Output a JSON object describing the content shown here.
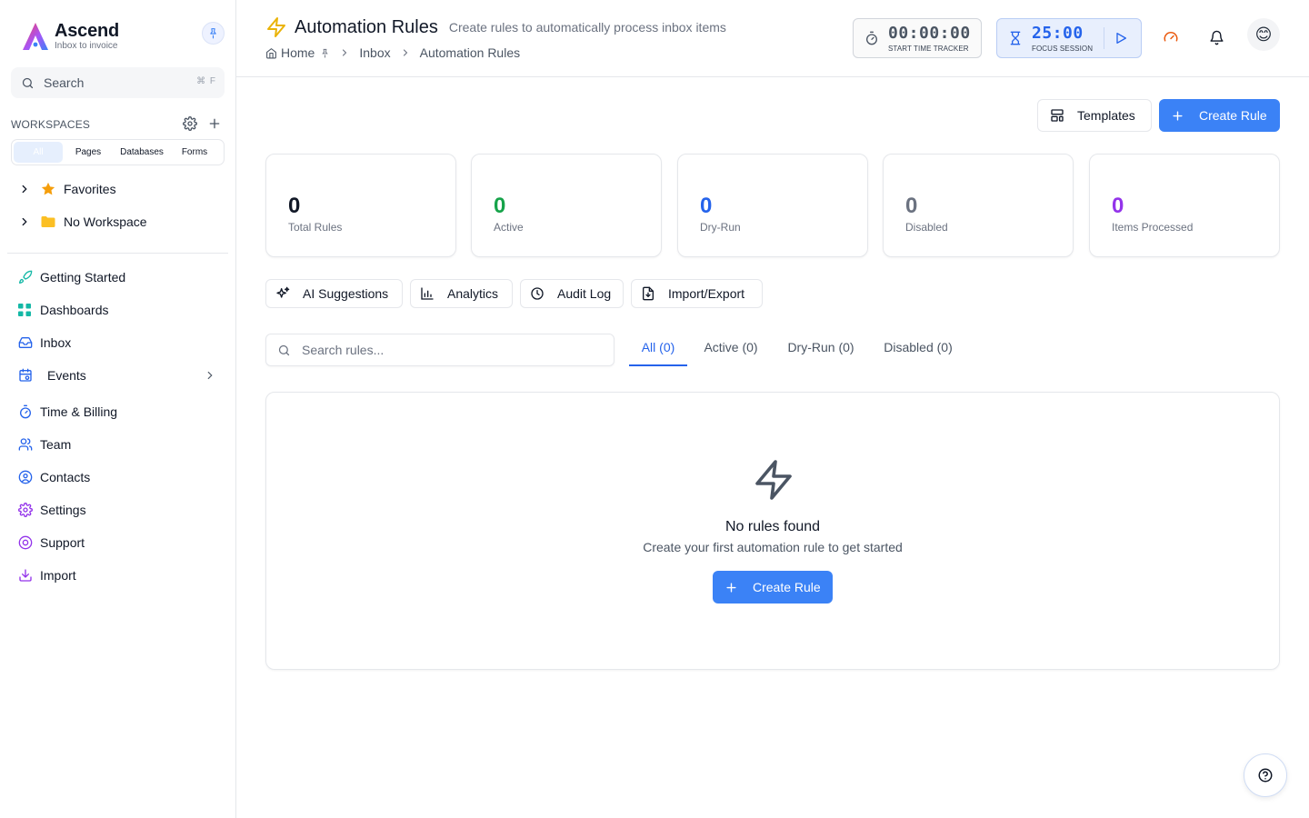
{
  "app": {
    "name": "Ascend",
    "tagline": "Inbox to invoice"
  },
  "sidebar": {
    "search_label": "Search",
    "search_shortcut": "⌘ F",
    "workspaces_title": "WORKSPACES",
    "ws_tabs": [
      "All",
      "Pages",
      "Databases",
      "Forms"
    ],
    "tree": [
      {
        "label": "Favorites",
        "icon": "star-icon"
      },
      {
        "label": "No Workspace",
        "icon": "folder-icon"
      }
    ],
    "nav": [
      {
        "label": "Getting Started",
        "icon": "rocket-icon"
      },
      {
        "label": "Dashboards",
        "icon": "grid-icon"
      },
      {
        "label": "Inbox",
        "icon": "inbox-icon"
      },
      {
        "label": "Events",
        "icon": "calendar-icon"
      },
      {
        "label": "Time & Billing",
        "icon": "timer-icon"
      },
      {
        "label": "Team",
        "icon": "users-icon"
      },
      {
        "label": "Contacts",
        "icon": "contact-icon"
      },
      {
        "label": "Settings",
        "icon": "gear-icon"
      },
      {
        "label": "Support",
        "icon": "lifebuoy-icon"
      },
      {
        "label": "Import",
        "icon": "download-icon"
      }
    ]
  },
  "header": {
    "title": "Automation Rules",
    "subtitle": "Create rules to automatically process inbox items",
    "breadcrumb": [
      "Home",
      "Inbox",
      "Automation Rules"
    ],
    "time_tracker": {
      "value": "00:00:00",
      "caption": "START TIME TRACKER"
    },
    "focus_session": {
      "value": "25:00",
      "caption": "FOCUS SESSION"
    },
    "avatar_emoji": "😊"
  },
  "actions": {
    "templates": "Templates",
    "create_rule": "Create Rule"
  },
  "stats": [
    {
      "value": "0",
      "label": "Total Rules",
      "color": "#111827"
    },
    {
      "value": "0",
      "label": "Active",
      "color": "#16a34a"
    },
    {
      "value": "0",
      "label": "Dry-Run",
      "color": "#2563eb"
    },
    {
      "value": "0",
      "label": "Disabled",
      "color": "#6b7280"
    },
    {
      "value": "0",
      "label": "Items Processed",
      "color": "#9333ea"
    }
  ],
  "tools": [
    "AI Suggestions",
    "Analytics",
    "Audit Log",
    "Import/Export"
  ],
  "rule_search_placeholder": "Search rules...",
  "filter_tabs": [
    "All (0)",
    "Active (0)",
    "Dry-Run (0)",
    "Disabled (0)"
  ],
  "empty_state": {
    "title": "No rules found",
    "description": "Create your first automation rule to get started",
    "button": "Create Rule"
  },
  "colors": {
    "accent": "#3b82f6",
    "brand_gradient": [
      "#f43f5e",
      "#3b82f6"
    ]
  }
}
